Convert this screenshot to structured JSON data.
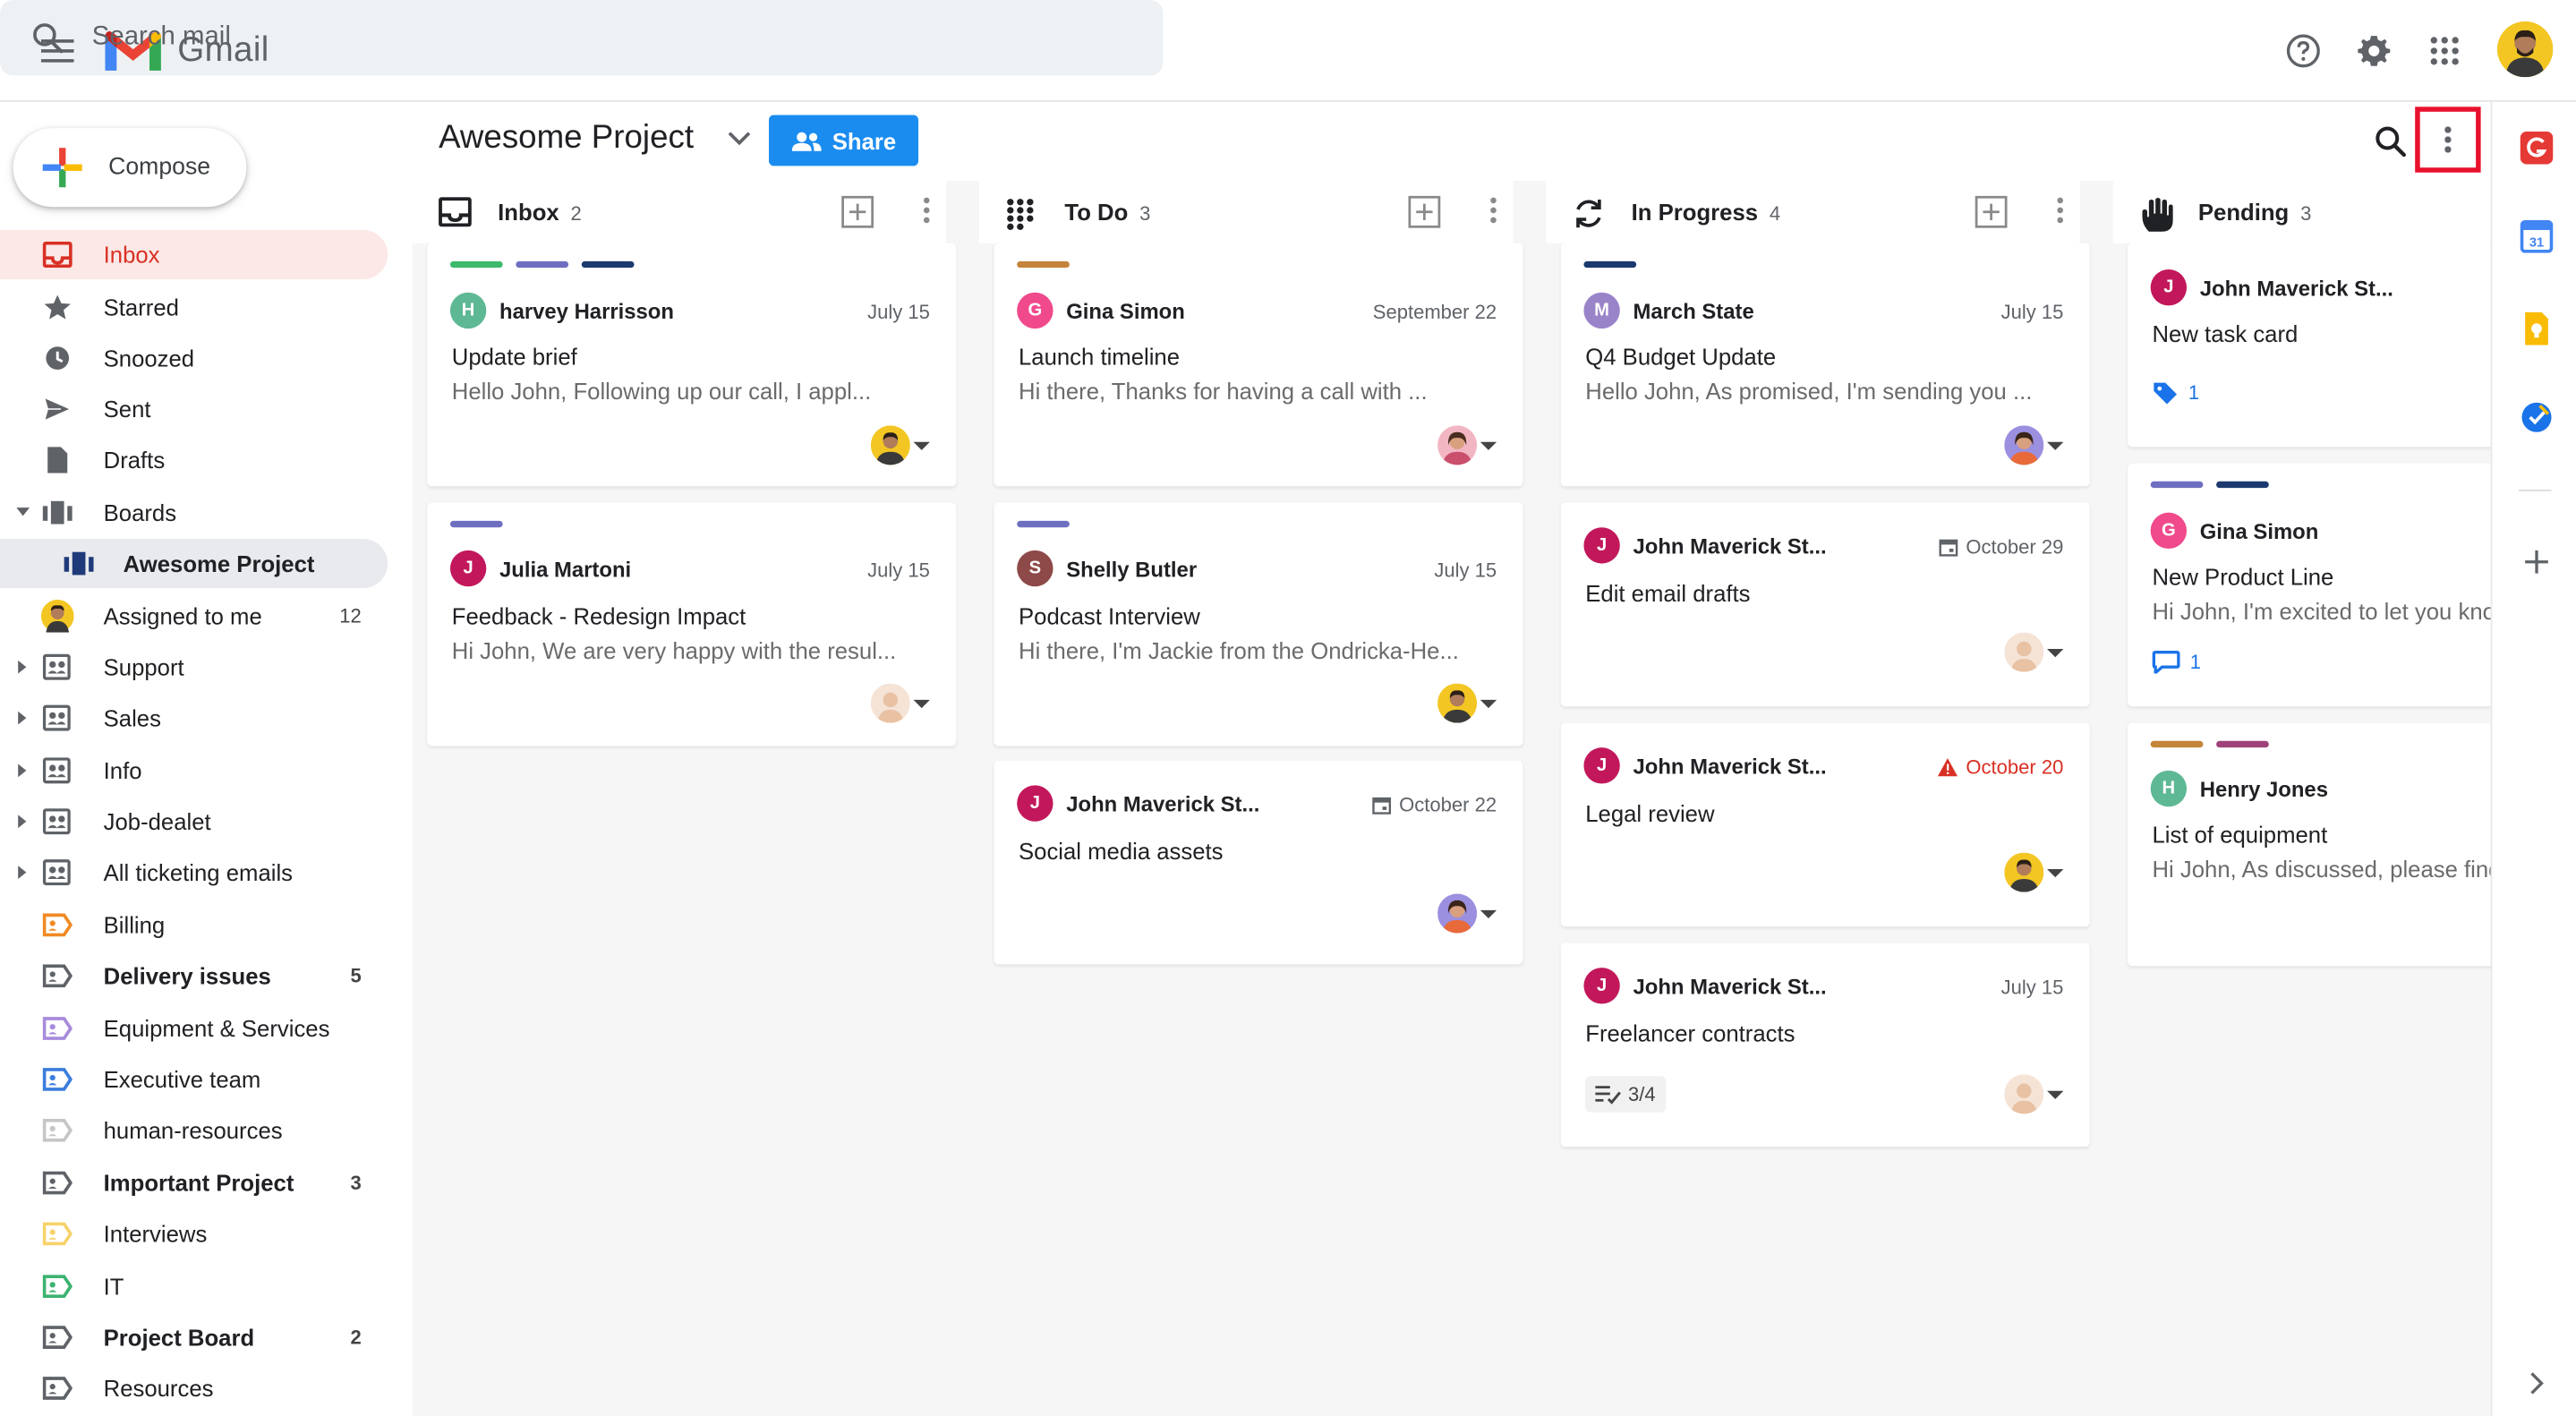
{
  "header": {
    "app_name": "Gmail",
    "search_placeholder": "Search mail"
  },
  "sidebar": {
    "compose_label": "Compose",
    "items": [
      {
        "label": "Inbox",
        "count": ""
      },
      {
        "label": "Starred",
        "count": ""
      },
      {
        "label": "Snoozed",
        "count": ""
      },
      {
        "label": "Sent",
        "count": ""
      },
      {
        "label": "Drafts",
        "count": ""
      },
      {
        "label": "Boards",
        "count": ""
      },
      {
        "label": "Awesome Project",
        "count": ""
      },
      {
        "label": "Assigned to me",
        "count": "12"
      },
      {
        "label": "Support",
        "count": ""
      },
      {
        "label": "Sales",
        "count": ""
      },
      {
        "label": "Info",
        "count": ""
      },
      {
        "label": "Job-dealet",
        "count": ""
      },
      {
        "label": "All ticketing emails",
        "count": ""
      },
      {
        "label": "Billing",
        "count": ""
      },
      {
        "label": "Delivery issues",
        "count": "5"
      },
      {
        "label": "Equipment & Services",
        "count": ""
      },
      {
        "label": "Executive team",
        "count": ""
      },
      {
        "label": "human-resources",
        "count": ""
      },
      {
        "label": "Important Project",
        "count": "3"
      },
      {
        "label": "Interviews",
        "count": ""
      },
      {
        "label": "IT",
        "count": ""
      },
      {
        "label": "Project Board",
        "count": "2"
      },
      {
        "label": "Resources",
        "count": ""
      }
    ]
  },
  "board": {
    "title": "Awesome Project",
    "share_label": "Share",
    "columns": [
      {
        "name": "Inbox",
        "count": "2",
        "cards": [
          {
            "sender": "harvey Harrisson",
            "initial": "H",
            "date": "July 15",
            "subject": "Update brief",
            "snippet": "Hello John, Following up our call, I appl..."
          },
          {
            "sender": "Julia Martoni",
            "initial": "J",
            "date": "July 15",
            "subject": "Feedback - Redesign Impact",
            "snippet": "Hi John, We are very happy with the resul..."
          }
        ]
      },
      {
        "name": "To Do",
        "count": "3",
        "cards": [
          {
            "sender": "Gina Simon",
            "initial": "G",
            "date": "September 22",
            "subject": "Launch timeline",
            "snippet": "Hi there, Thanks for having a call with ..."
          },
          {
            "sender": "Shelly Butler",
            "initial": "S",
            "date": "July 15",
            "subject": "Podcast Interview",
            "snippet": "Hi there, I'm Jackie from the Ondricka-He..."
          },
          {
            "sender": "John Maverick St...",
            "initial": "J",
            "date": "October 22",
            "subject": "Social media assets",
            "snippet": ""
          }
        ]
      },
      {
        "name": "In Progress",
        "count": "4",
        "cards": [
          {
            "sender": "March State",
            "initial": "M",
            "date": "July 15",
            "subject": "Q4 Budget Update",
            "snippet": "Hello John, As promised, I'm sending you ..."
          },
          {
            "sender": "John Maverick St...",
            "initial": "J",
            "date": "October 29",
            "subject": "Edit email drafts",
            "snippet": ""
          },
          {
            "sender": "John Maverick St...",
            "initial": "J",
            "date": "October 20",
            "subject": "Legal review",
            "snippet": ""
          },
          {
            "sender": "John Maverick St...",
            "initial": "J",
            "date": "July 15",
            "subject": "Freelancer contracts",
            "snippet": "",
            "checklist": "3/4"
          }
        ]
      },
      {
        "name": "Pending",
        "count": "3",
        "cards": [
          {
            "sender": "John Maverick St...",
            "initial": "J",
            "date": "",
            "subject": "New task card",
            "snippet": "",
            "tag_count": "1"
          },
          {
            "sender": "Gina Simon",
            "initial": "G",
            "date": "",
            "subject": "New Product Line",
            "snippet": "Hi John, I'm excited to let you kno",
            "comment_count": "1"
          },
          {
            "sender": "Henry Jones",
            "initial": "H",
            "date": "",
            "subject": "List of equipment",
            "snippet": "Hi John, As discussed, please find"
          }
        ]
      }
    ]
  },
  "colors": {
    "accent": "#1a8cf0",
    "inbox_active": "#d93025",
    "highlight_box": "#e8112d"
  }
}
